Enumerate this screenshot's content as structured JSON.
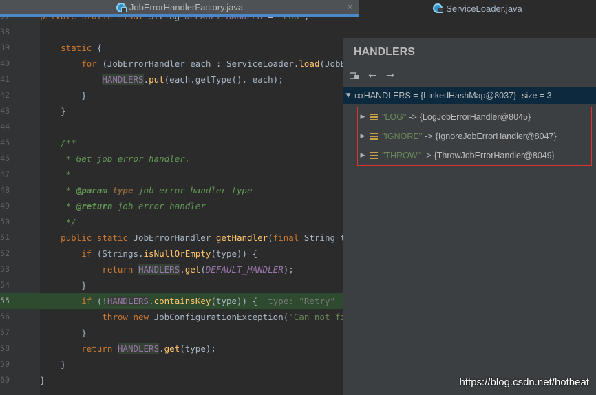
{
  "tabs": {
    "active": "JobErrorHandlerFactory.java",
    "inactive": "ServiceLoader.java",
    "close_glyph": "×"
  },
  "editor": {
    "lines": [
      {
        "n": "37",
        "parts": [
          [
            "kw",
            "private static final "
          ],
          [
            "cls",
            "String "
          ],
          [
            "fld",
            "DEFAULT_HANDLER"
          ],
          [
            "cls",
            " = "
          ],
          [
            "str",
            "\"LOG\""
          ],
          [
            "cls",
            ";"
          ]
        ]
      },
      {
        "n": "38",
        "parts": []
      },
      {
        "n": "39",
        "parts": [
          [
            "kw",
            "    static "
          ],
          [
            "cls",
            "{"
          ]
        ]
      },
      {
        "n": "40",
        "parts": [
          [
            "kw",
            "        for "
          ],
          [
            "cls",
            "("
          ],
          [
            "cls",
            "JobErrorHandler "
          ],
          [
            "param",
            "each"
          ],
          [
            "cls",
            " : ServiceLoader."
          ],
          [
            "mth",
            "load"
          ],
          [
            "cls",
            "(JobErrorH"
          ]
        ]
      },
      {
        "n": "41",
        "parts": [
          [
            "cls",
            "            "
          ],
          [
            "hl",
            "HANDLERS"
          ],
          [
            "cls",
            "."
          ],
          [
            "mth",
            "put"
          ],
          [
            "cls",
            "(each.getType(), each);"
          ]
        ]
      },
      {
        "n": "42",
        "parts": [
          [
            "cls",
            "        }"
          ]
        ]
      },
      {
        "n": "43",
        "parts": [
          [
            "cls",
            "    }"
          ]
        ]
      },
      {
        "n": "44",
        "parts": []
      },
      {
        "n": "45",
        "parts": [
          [
            "cmt",
            "    /**"
          ]
        ]
      },
      {
        "n": "46",
        "parts": [
          [
            "cmt",
            "     * Get job error handler."
          ]
        ]
      },
      {
        "n": "47",
        "parts": [
          [
            "cmt",
            "     *"
          ]
        ]
      },
      {
        "n": "48",
        "parts": [
          [
            "cmt",
            "     * "
          ],
          [
            "tag",
            "@param "
          ],
          [
            "tagk",
            "type "
          ],
          [
            "cmt",
            "job error handler type"
          ]
        ]
      },
      {
        "n": "49",
        "parts": [
          [
            "cmt",
            "     * "
          ],
          [
            "tag",
            "@return "
          ],
          [
            "cmt",
            "job error handler"
          ]
        ]
      },
      {
        "n": "50",
        "parts": [
          [
            "cmt",
            "     */"
          ]
        ]
      },
      {
        "n": "51",
        "parts": [
          [
            "kw",
            "    public static "
          ],
          [
            "cls",
            "JobErrorHandler "
          ],
          [
            "mth",
            "getHandler"
          ],
          [
            "cls",
            "("
          ],
          [
            "kw",
            "final "
          ],
          [
            "cls",
            "String type)"
          ]
        ]
      },
      {
        "n": "52",
        "parts": [
          [
            "kw",
            "        if "
          ],
          [
            "cls",
            "(Strings."
          ],
          [
            "mth",
            "isNullOrEmpty"
          ],
          [
            "cls",
            "(type)) {"
          ]
        ]
      },
      {
        "n": "53",
        "parts": [
          [
            "kw",
            "            return "
          ],
          [
            "hl",
            "HANDLERS"
          ],
          [
            "cls",
            "."
          ],
          [
            "mth",
            "get"
          ],
          [
            "cls",
            "("
          ],
          [
            "fld",
            "DEFAULT_HANDLER"
          ],
          [
            "cls",
            ");"
          ]
        ]
      },
      {
        "n": "54",
        "parts": [
          [
            "cls",
            "        }"
          ]
        ]
      },
      {
        "n": "55",
        "parts": [
          [
            "kw",
            "        if "
          ],
          [
            "cls",
            "(!"
          ],
          [
            "hl",
            "HANDLERS"
          ],
          [
            "cls",
            "."
          ],
          [
            "mth",
            "containsKey"
          ],
          [
            "cls",
            "(type)) {  "
          ],
          [
            "grey",
            "type: \"Retry\""
          ]
        ]
      },
      {
        "n": "56",
        "parts": [
          [
            "kw",
            "            throw new "
          ],
          [
            "cls",
            "JobConfigurationException("
          ],
          [
            "str",
            "\"Can not find jo"
          ]
        ]
      },
      {
        "n": "57",
        "parts": [
          [
            "cls",
            "        }"
          ]
        ]
      },
      {
        "n": "58",
        "parts": [
          [
            "kw",
            "        return "
          ],
          [
            "hl",
            "HANDLERS"
          ],
          [
            "cls",
            "."
          ],
          [
            "mth",
            "get"
          ],
          [
            "cls",
            "(type);"
          ]
        ]
      },
      {
        "n": "59",
        "parts": [
          [
            "cls",
            "    }"
          ]
        ]
      },
      {
        "n": "60",
        "parts": [
          [
            "cls",
            "}"
          ]
        ]
      }
    ],
    "execution_line": "55"
  },
  "popup": {
    "title": "HANDLERS",
    "root": {
      "label": "HANDLERS = {LinkedHashMap@8037}",
      "size": "size = 3"
    },
    "children": [
      {
        "key": "\"LOG\"",
        "arrow": "->",
        "value": "{LogJobErrorHandler@8045}"
      },
      {
        "key": "\"IGNORE\"",
        "arrow": "->",
        "value": "{IgnoreJobErrorHandler@8047}"
      },
      {
        "key": "\"THROW\"",
        "arrow": "->",
        "value": "{ThrowJobErrorHandler@8049}"
      }
    ]
  },
  "watermark": "https://blog.csdn.net/hotbeat"
}
